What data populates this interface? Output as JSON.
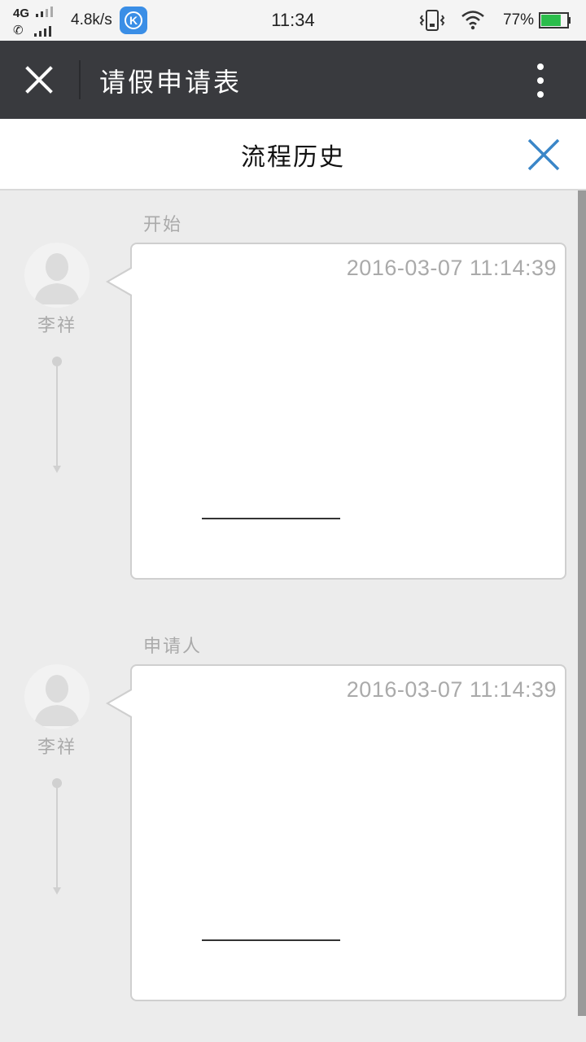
{
  "status_bar": {
    "network": "4G",
    "speed": "4.8k/s",
    "app_icon_letter": "K",
    "time": "11:34",
    "battery_percent": "77%",
    "battery_level": 0.77,
    "battery_color": "#2bbd4b"
  },
  "title_bar": {
    "title": "请假申请表",
    "close_icon": "close-icon",
    "more_icon": "more-vertical-icon"
  },
  "panel": {
    "title": "流程历史",
    "close_icon": "close-icon",
    "accent_color": "#3a86c8"
  },
  "timeline": [
    {
      "step": "开始",
      "user": "李祥",
      "timestamp": "2016-03-07 11:14:39"
    },
    {
      "step": "申请人",
      "user": "李祥",
      "timestamp": "2016-03-07 11:14:39"
    }
  ]
}
